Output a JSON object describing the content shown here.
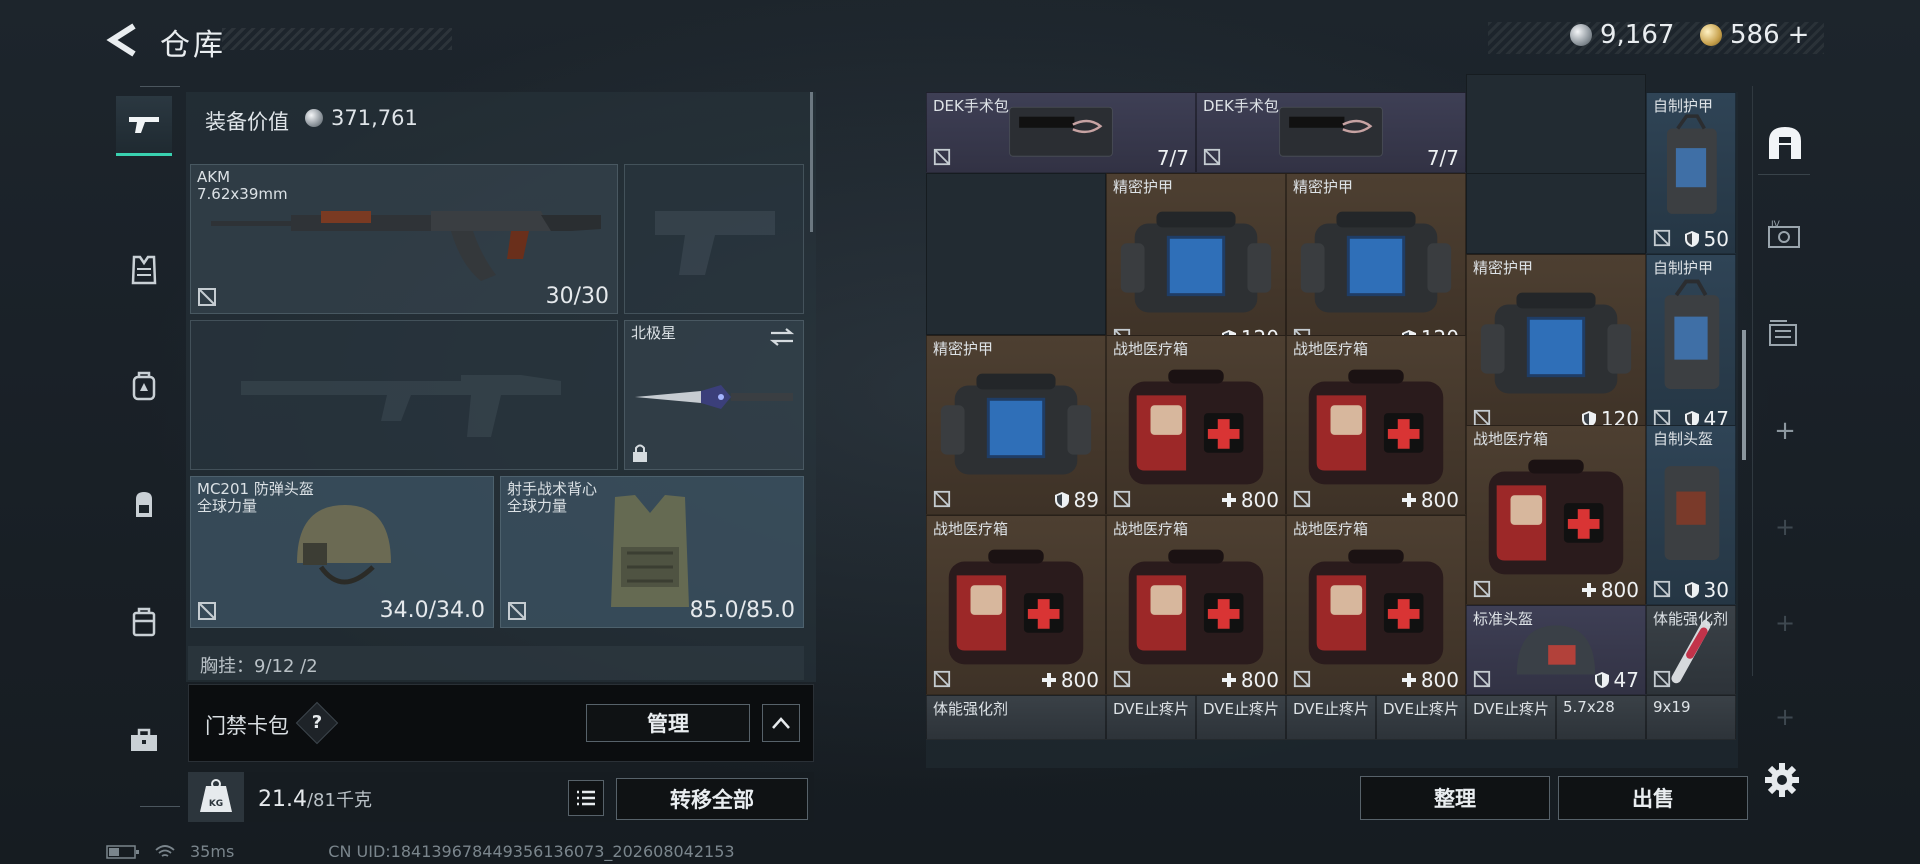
{
  "header": {
    "title": "仓库"
  },
  "currency": {
    "silver": "9,167",
    "gold": "586",
    "gold_add": "+"
  },
  "equipment": {
    "value_label": "装备价值",
    "value": "371,761",
    "primary_weapon": {
      "name": "AKM",
      "ammo": "7.62x39mm",
      "durability": "30/30"
    },
    "melee": {
      "name": "北极星"
    },
    "helmet": {
      "name": "MC201 防弹头盔",
      "faction": "全球力量",
      "durability": "34.0/34.0"
    },
    "vest": {
      "name": "射手战术背心",
      "faction": "全球力量",
      "durability": "85.0/85.0"
    },
    "chest_rig": {
      "text": "胸挂：9/12 /2"
    }
  },
  "keybag": {
    "label": "门禁卡包",
    "help": "?",
    "manage": "管理"
  },
  "weight": {
    "current": "21.4",
    "max": "/81千克",
    "kg_icon": "KG",
    "transfer_all": "转移全部"
  },
  "status": {
    "ping": "35ms",
    "uid": "CN UID:1841396784493561360​73_202608042153"
  },
  "grid": {
    "items": [
      {
        "name": "DEK手术包",
        "value": "7/7"
      },
      {
        "name": "DEK手术包",
        "value": "7/7"
      },
      {
        "name": "自制护甲",
        "value": "50"
      },
      {
        "name": "精密护甲",
        "value": "120"
      },
      {
        "name": "精密护甲",
        "value": "120"
      },
      {
        "name": "精密护甲",
        "value": "120"
      },
      {
        "name": "自制护甲",
        "value": "47"
      },
      {
        "name": "精密护甲",
        "value": "89"
      },
      {
        "name": "战地医疗箱",
        "value": "800"
      },
      {
        "name": "战地医疗箱",
        "value": "800"
      },
      {
        "name": "战地医疗箱",
        "value": "800"
      },
      {
        "name": "自制头盔",
        "value": "30"
      },
      {
        "name": "战地医疗箱",
        "value": "800"
      },
      {
        "name": "战地医疗箱",
        "value": "800"
      },
      {
        "name": "战地医疗箱",
        "value": "800"
      },
      {
        "name": "标准头盔",
        "value": "47"
      },
      {
        "name": "体能强化剂",
        "value": ""
      },
      {
        "name": "体能强化剂",
        "value": ""
      },
      {
        "name": "DVE止疼片",
        "value": ""
      },
      {
        "name": "DVE止疼片",
        "value": ""
      },
      {
        "name": "DVE止疼片",
        "value": ""
      },
      {
        "name": "DVE止疼片",
        "value": ""
      },
      {
        "name": "DVE止疼片",
        "value": ""
      },
      {
        "name": "5.7x28",
        "value": ""
      },
      {
        "name": "9x19",
        "value": ""
      }
    ],
    "sort": "整理",
    "sell": "出售"
  }
}
